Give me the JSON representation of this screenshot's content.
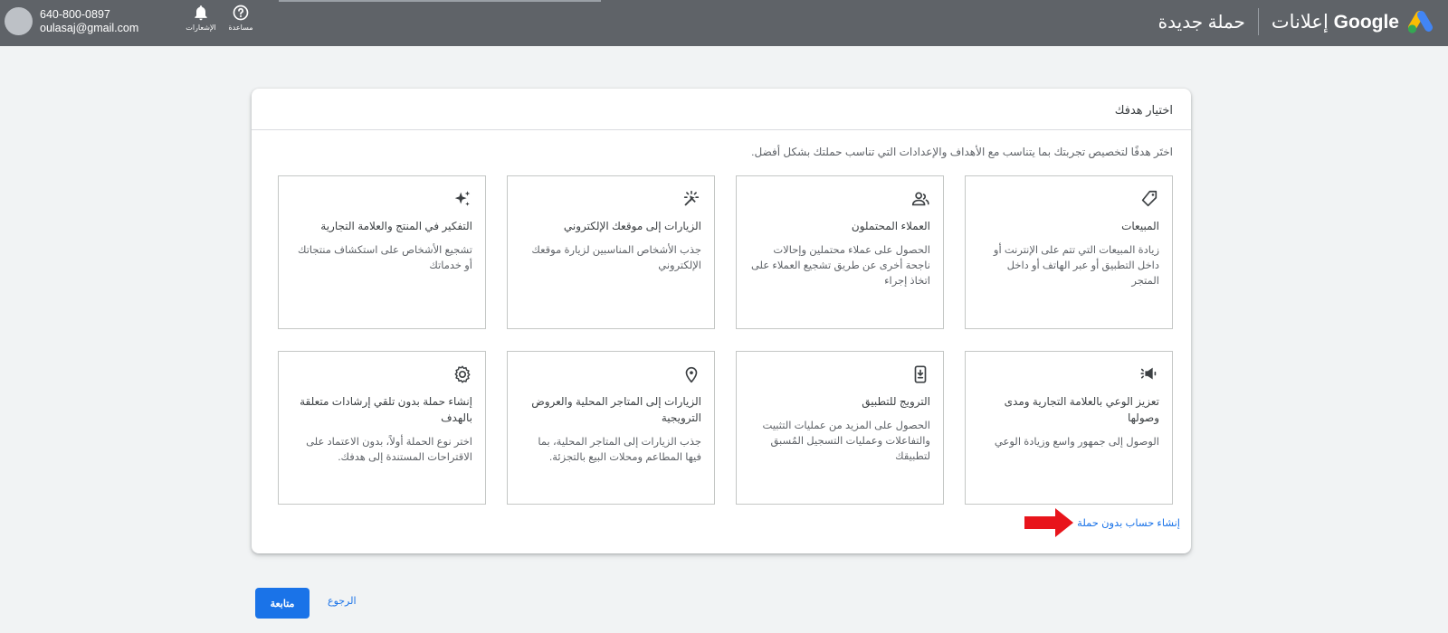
{
  "header": {
    "phone": "640-800-0897",
    "email": "oulasaj@gmail.com",
    "notifications_label": "الإشعارات",
    "help_label": "مساعدة",
    "brand_word": "Google",
    "brand_rest": "إعلانات",
    "page_title": "حملة جديدة"
  },
  "card": {
    "title": "اختيار هدفك",
    "description": "اختَر هدفًا لتخصيص تجربتك بما يتناسب مع الأهداف والإعدادات التي تناسب حملتك بشكل أفضل.",
    "goals": [
      {
        "icon": "tag-icon",
        "title": "المبيعات",
        "text": "زيادة المبيعات التي تتم على الإنترنت أو داخل التطبيق أو عبر الهاتف أو داخل المتجر"
      },
      {
        "icon": "people-icon",
        "title": "العملاء المحتملون",
        "text": "الحصول على عملاء محتملين وإحالات ناجحة أخرى عن طريق تشجيع العملاء على اتخاذ إجراء"
      },
      {
        "icon": "cursor-click-icon",
        "title": "الزيارات إلى موقعك الإلكتروني",
        "text": "جذب الأشخاص المناسبين لزيارة موقعك الإلكتروني"
      },
      {
        "icon": "sparkle-icon",
        "title": "التفكير في المنتج والعلامة التجارية",
        "text": "تشجيع الأشخاص على استكشاف منتجاتك أو خدماتك"
      },
      {
        "icon": "megaphone-icon",
        "title": "تعزيز الوعي بالعلامة التجارية ومدى وصولها",
        "text": "الوصول إلى جمهور واسع وزيادة الوعي"
      },
      {
        "icon": "phone-download-icon",
        "title": "الترويج للتطبيق",
        "text": "الحصول على المزيد من عمليات التثبيت والتفاعلات وعمليات التسجيل المُسبق لتطبيقك"
      },
      {
        "icon": "location-pin-icon",
        "title": "الزيارات إلى المتاجر المحلية والعروض الترويجية",
        "text": "جذب الزيارات إلى المتاجر المحلية، بما فيها المطاعم ومحلات البيع بالتجزئة."
      },
      {
        "icon": "gear-icon",
        "title": "إنشاء حملة بدون تلقي إرشادات متعلقة بالهدف",
        "text": "اختر نوع الحملة أولاً، بدون الاعتماد على الاقتراحات المستندة إلى هدفك."
      }
    ],
    "no_campaign_link": "إنشاء حساب بدون حملة"
  },
  "footer": {
    "continue_label": "متابعة",
    "back_label": "الرجوع"
  },
  "colors": {
    "header_bg": "#5f6368",
    "primary_blue": "#1a73e8",
    "annotation_red": "#e8141b"
  }
}
